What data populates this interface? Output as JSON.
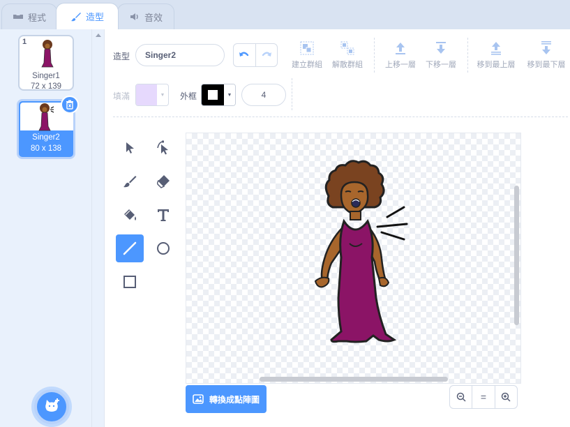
{
  "tabs": {
    "code": "程式",
    "costumes": "造型",
    "sounds": "音效"
  },
  "costumes": [
    {
      "index": "1",
      "name": "Singer1",
      "size": "72 x 139"
    },
    {
      "index": "2",
      "name": "Singer2",
      "size": "80 x 138"
    }
  ],
  "editor": {
    "costume_label": "造型",
    "costume_name": "Singer2",
    "fill_label": "填滿",
    "outline_label": "外框",
    "outline_width": "4",
    "group": "建立群組",
    "ungroup": "解散群組",
    "forward": "上移一層",
    "backward": "下移一層",
    "front": "移到最上層",
    "back": "移到最下層",
    "convert_bitmap": "轉換成點陣圖",
    "zoom_reset": "="
  },
  "colors": {
    "accent": "#4c97ff",
    "fill": "#e6d9fd",
    "outline": "#000000"
  },
  "icons": {
    "add_costume": "cat-plus-icon",
    "delete": "trash-icon"
  }
}
